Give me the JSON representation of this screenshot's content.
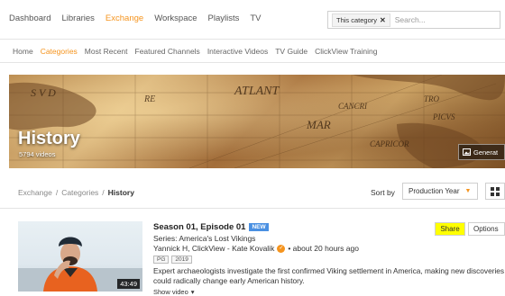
{
  "top_nav": {
    "items": [
      "Dashboard",
      "Libraries",
      "Exchange",
      "Workspace",
      "Playlists",
      "TV"
    ],
    "active": "Exchange"
  },
  "search": {
    "chip_label": "This category",
    "placeholder": "Search..."
  },
  "sub_nav": {
    "items": [
      "Home",
      "Categories",
      "Most Recent",
      "Featured Channels",
      "Interactive Videos",
      "TV Guide",
      "ClickView Training"
    ],
    "active": "Categories"
  },
  "banner": {
    "title": "History",
    "count": "5794 videos",
    "map_words": [
      "ATLANT",
      "MAR",
      "CANCRI",
      "CAPRICOR",
      "S V D",
      "RE",
      "TRO",
      "PICVS"
    ],
    "generate_label": "Generat"
  },
  "breadcrumb": {
    "items": [
      "Exchange",
      "Categories",
      "History"
    ],
    "separator": "/"
  },
  "sort": {
    "label": "Sort by",
    "value": "Production Year"
  },
  "video": {
    "title": "Season 01, Episode 01",
    "badge": "NEW",
    "series": "Series: America's Lost Vikings",
    "meta_author": "Yannick H, ClickView - Kate Kovalik",
    "meta_time": "• about 20 hours ago",
    "tags": [
      "PG",
      "2019"
    ],
    "description_line1": "Expert archaeologists investigate the first confirmed Viking settlement in America, making new discoveries",
    "description_line2": "could radically change early American history.",
    "show_more": "Show video",
    "duration": "43:49",
    "share_label": "Share",
    "options_label": "Options"
  },
  "colors": {
    "accent": "#f5941e",
    "share_highlight": "#ffff00",
    "new_badge": "#4a90e2"
  }
}
